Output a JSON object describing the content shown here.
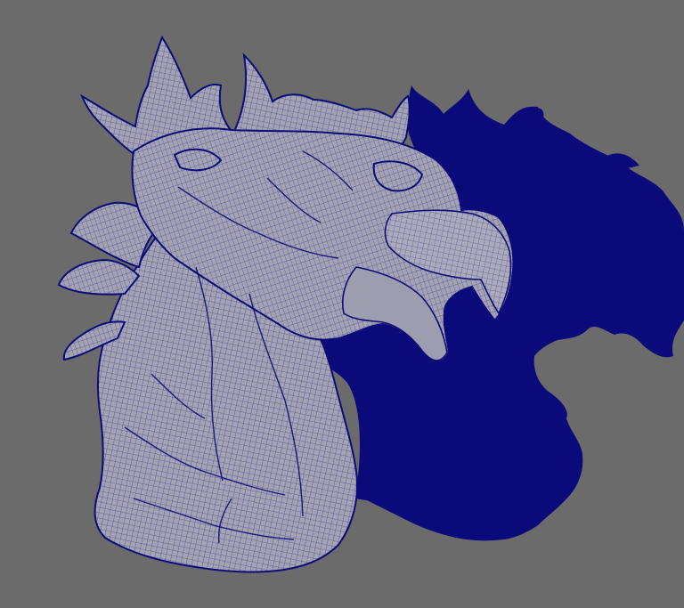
{
  "viewport": {
    "background_color": "#6b6b6b",
    "mesh_fill_color": "#a3a3b4",
    "wire_color": "#0c0c78",
    "shadow_color": "#0a0a7a"
  },
  "icons": {
    "model": "eagle-head-sculpt-wireframe"
  }
}
